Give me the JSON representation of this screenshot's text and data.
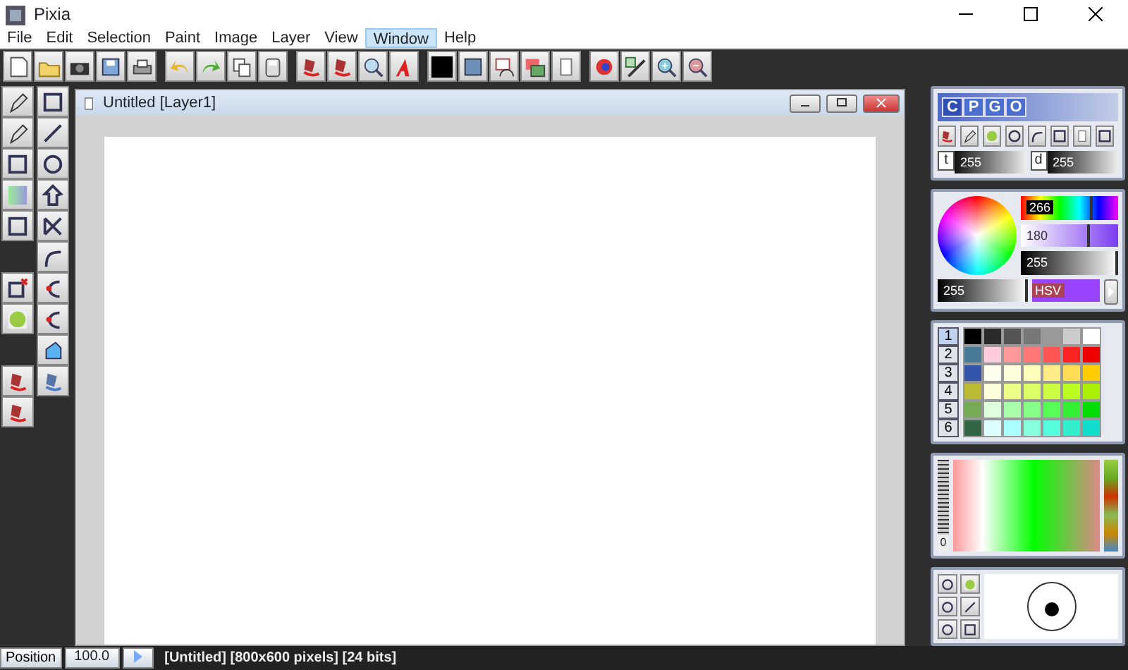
{
  "window": {
    "title": "Pixia"
  },
  "menu": [
    {
      "label": "File",
      "selected": false
    },
    {
      "label": "Edit",
      "selected": false
    },
    {
      "label": "Selection",
      "selected": false
    },
    {
      "label": "Paint",
      "selected": false
    },
    {
      "label": "Image",
      "selected": false
    },
    {
      "label": "Layer",
      "selected": false
    },
    {
      "label": "View",
      "selected": false
    },
    {
      "label": "Window",
      "selected": true
    },
    {
      "label": "Help",
      "selected": false
    }
  ],
  "document": {
    "title": "Untitled [Layer1]"
  },
  "panel": {
    "tabs": [
      {
        "label": "C",
        "selected": true
      },
      {
        "label": "P",
        "selected": false
      },
      {
        "label": "G",
        "selected": false
      },
      {
        "label": "O",
        "selected": false
      }
    ],
    "fields": [
      {
        "label": "t",
        "value": "255"
      },
      {
        "label": "d",
        "value": "255"
      }
    ],
    "color_values": [
      {
        "value": "266",
        "level": 0.74
      },
      {
        "value": "180",
        "level": 0.71
      },
      {
        "value": "255",
        "level": 1
      },
      {
        "value": "255",
        "level": 1
      }
    ],
    "mode_button": "HSV",
    "palette_tabs": [
      {
        "label": "1",
        "selected": true
      },
      {
        "label": "2",
        "selected": false
      },
      {
        "label": "3",
        "selected": false
      },
      {
        "label": "4",
        "selected": false
      },
      {
        "label": "5",
        "selected": false
      },
      {
        "label": "6",
        "selected": false
      }
    ],
    "gradient_scale": "0"
  },
  "status_bar": {
    "position_button": "Position",
    "zoom": "100.0",
    "info": "[Untitled] [800x600 pixels] [24 bits]"
  }
}
